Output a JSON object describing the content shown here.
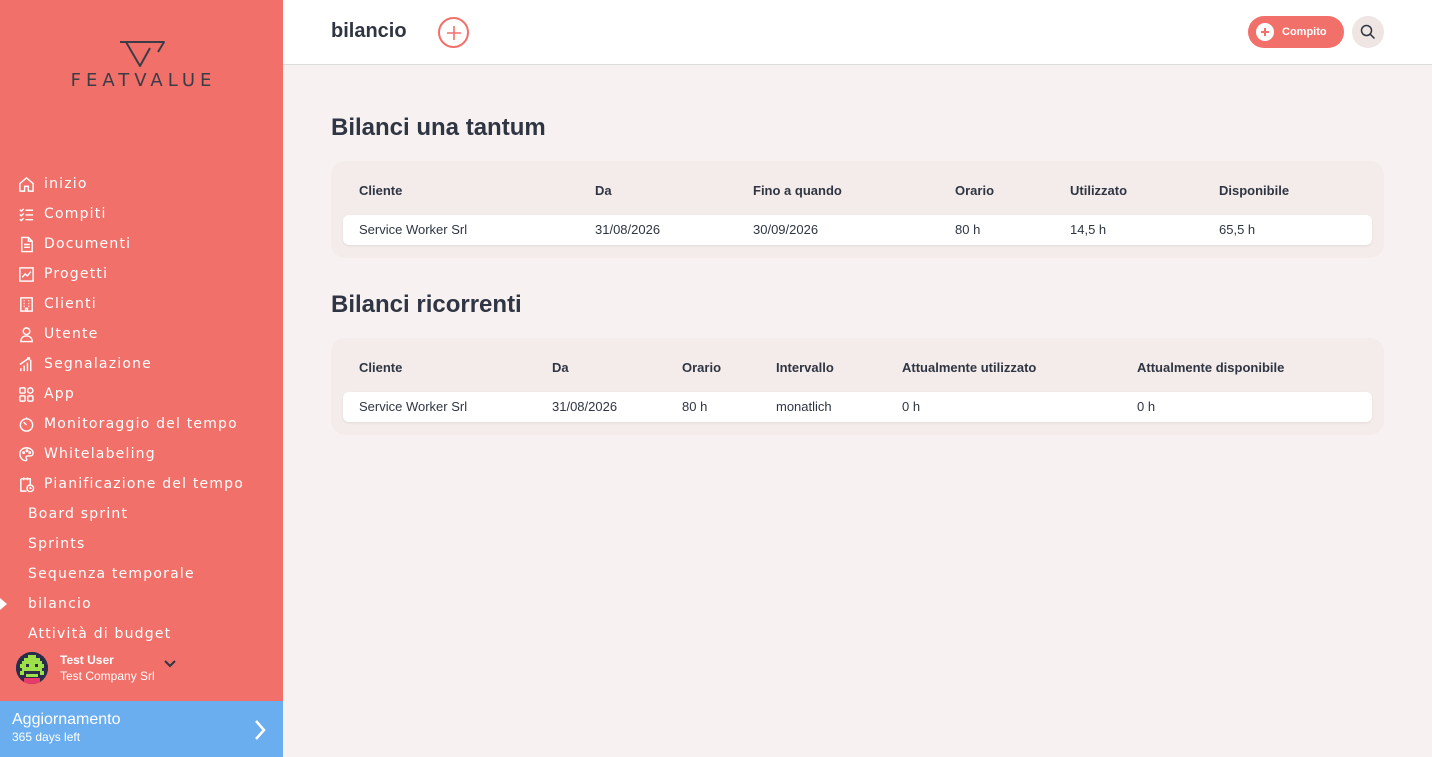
{
  "brand": {
    "logo_text": "FEATVALUE"
  },
  "sidebar": {
    "items": [
      {
        "label": "inizio",
        "icon": "home-icon"
      },
      {
        "label": "Compiti",
        "icon": "checklist-icon"
      },
      {
        "label": "Documenti",
        "icon": "document-icon"
      },
      {
        "label": "Progetti",
        "icon": "chart-icon"
      },
      {
        "label": "Clienti",
        "icon": "building-icon"
      },
      {
        "label": "Utente",
        "icon": "user-icon"
      },
      {
        "label": "Segnalazione",
        "icon": "report-icon"
      },
      {
        "label": "App",
        "icon": "apps-icon"
      },
      {
        "label": "Monitoraggio del tempo",
        "icon": "timer-icon"
      },
      {
        "label": "Whitelabeling",
        "icon": "palette-icon"
      },
      {
        "label": "Pianificazione del tempo",
        "icon": "calendar-clock-icon"
      }
    ],
    "subitems": [
      {
        "label": "Board sprint"
      },
      {
        "label": "Sprints"
      },
      {
        "label": "Sequenza temporale"
      },
      {
        "label": "bilancio",
        "active": true
      },
      {
        "label": "Attività di budget"
      }
    ],
    "user": {
      "name": "Test User",
      "company": "Test Company Srl"
    },
    "upgrade": {
      "title": "Aggiornamento",
      "subtitle": "365 days left"
    }
  },
  "topbar": {
    "title": "bilancio",
    "task_button": "Compito"
  },
  "one_time": {
    "title": "Bilanci una tantum",
    "columns": [
      "Cliente",
      "Da",
      "Fino a quando",
      "Orario",
      "Utilizzato",
      "Disponibile"
    ],
    "rows": [
      [
        "Service Worker Srl",
        "31/08/2026",
        "30/09/2026",
        "80 h",
        "14,5 h",
        "65,5 h"
      ]
    ]
  },
  "recurring": {
    "title": "Bilanci ricorrenti",
    "columns": [
      "Cliente",
      "Da",
      "Orario",
      "Intervallo",
      "Attualmente utilizzato",
      "Attualmente disponibile"
    ],
    "rows": [
      [
        "Service Worker Srl",
        "31/08/2026",
        "80 h",
        "monatlich",
        "0 h",
        "0 h"
      ]
    ]
  },
  "colors": {
    "accent": "#f2706a",
    "upgrade": "#6aaef0",
    "background": "#f7f2f1",
    "text": "#2f3542"
  }
}
